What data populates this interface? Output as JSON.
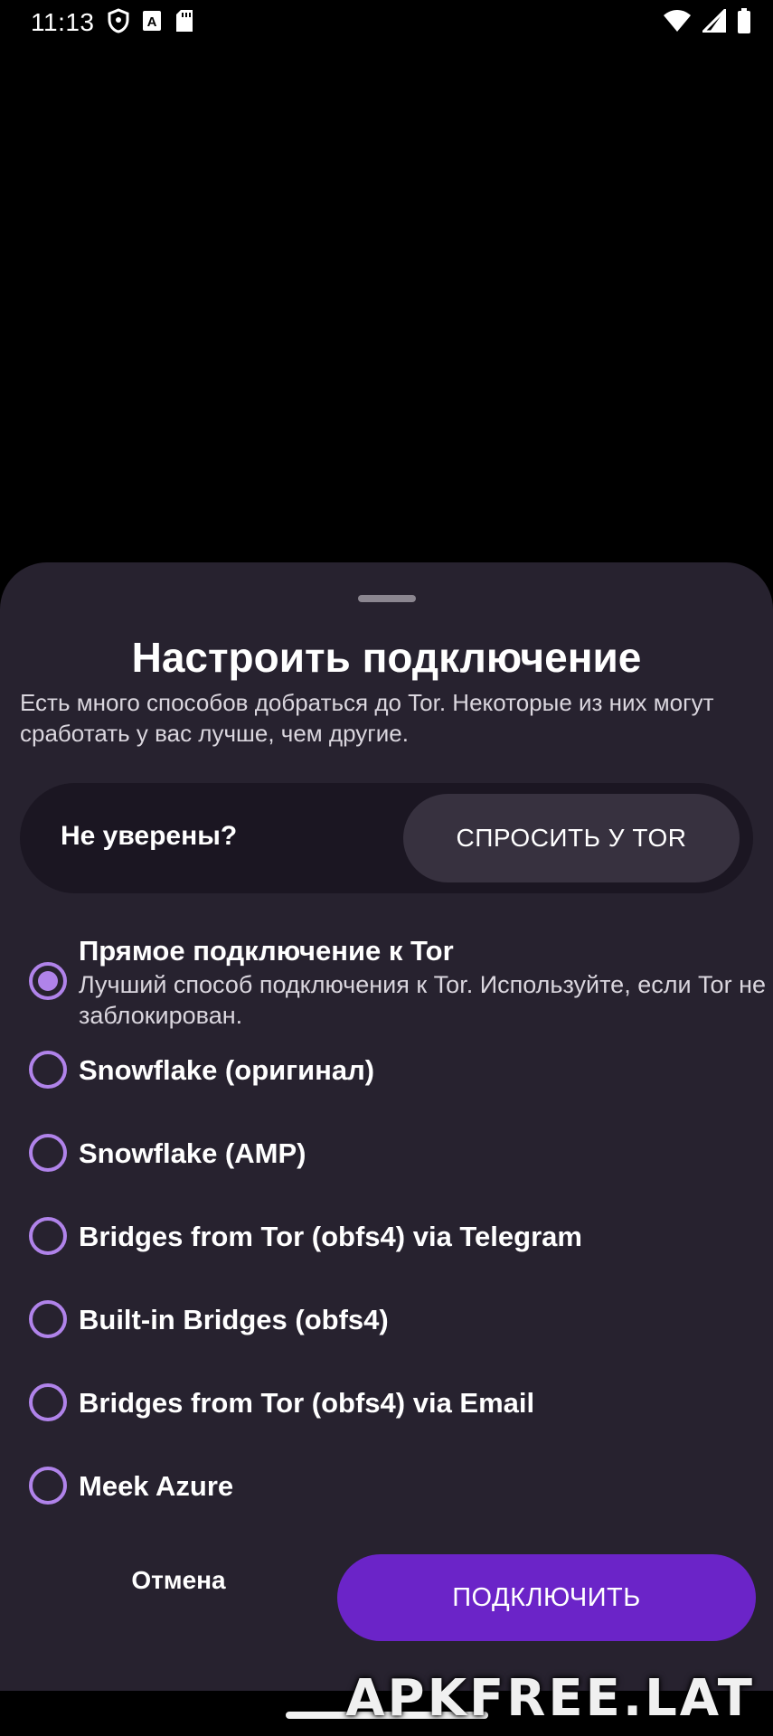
{
  "status_bar": {
    "time": "11:13",
    "icons": [
      "shield-icon",
      "font-a-icon",
      "sd-card-icon",
      "wifi-icon",
      "signal-icon",
      "battery-icon"
    ]
  },
  "sheet": {
    "title": "Настроить подключение",
    "description": "Есть много способов добраться до Tor. Некоторые из них могут сработать у вас лучше, чем другие.",
    "ask": {
      "label": "Не уверены?",
      "button": "СПРОСИТЬ У TOR"
    },
    "options": [
      {
        "title": "Прямое подключение к Tor",
        "description": "Лучший способ подключения к Tor. Используйте, если Tor не заблокирован.",
        "selected": true
      },
      {
        "title": "Snowflake (оригинал)",
        "selected": false
      },
      {
        "title": "Snowflake (AMP)",
        "selected": false
      },
      {
        "title": "Bridges from Tor (obfs4) via Telegram",
        "selected": false
      },
      {
        "title": "Built-in Bridges (obfs4)",
        "selected": false
      },
      {
        "title": "Bridges from Tor (obfs4) via Email",
        "selected": false
      },
      {
        "title": "Meek Azure",
        "selected": false
      }
    ],
    "cancel_label": "Отмена",
    "connect_label": "ПОДКЛЮЧИТЬ"
  },
  "colors": {
    "accent": "#b083ea",
    "primary_button": "#6b24c8",
    "sheet_background": "#27222f"
  },
  "watermark": "APKFREE.LAT"
}
